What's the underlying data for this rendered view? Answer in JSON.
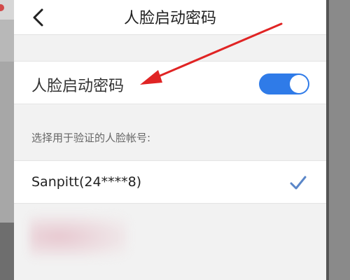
{
  "header": {
    "title": "人脸启动密码",
    "back_icon": "chevron-left-icon"
  },
  "setting": {
    "label": "人脸启动密码",
    "toggle_on": true,
    "toggle_color": "#2f7be8"
  },
  "accounts": {
    "hint": "选择用于验证的人脸帐号:",
    "selected": {
      "label": "Sanpitt(24****8)",
      "check_icon": "checkmark-icon",
      "check_color": "#5a86c8"
    }
  },
  "annotation": {
    "arrow_color": "#e02424"
  }
}
